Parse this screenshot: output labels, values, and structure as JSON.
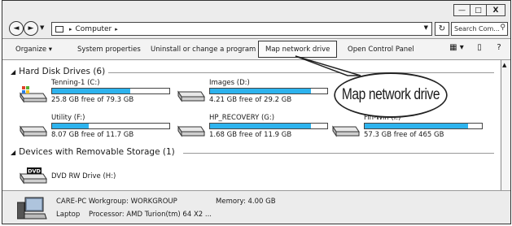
{
  "window": {
    "minimize": "—",
    "maximize": "□",
    "close": "X"
  },
  "address": {
    "back": "◄",
    "forward": "►",
    "separator": "▸",
    "path": "Computer",
    "path_separator": "▸",
    "dropdown": "▼",
    "refresh": "↻",
    "search_placeholder": "Search Com...",
    "search_icon": "magnifier-icon"
  },
  "toolbar": {
    "organize": "Organize ▾",
    "system_properties": "System properties",
    "uninstall": "Uninstall or change a program",
    "map_network_drive": "Map network drive",
    "open_control_panel": "Open Control Panel",
    "view_icon": "▦ ▾",
    "pane_icon": "▯",
    "help_icon": "?"
  },
  "groups": {
    "hard_disk": "Hard Disk Drives (6)",
    "removable": "Devices with Removable Storage (1)"
  },
  "drives": [
    {
      "name": "Tenning-1 (C:)",
      "free": "25.8 GB free of 79.3 GB",
      "used_fraction": 0.67
    },
    {
      "name": "Images (D:)",
      "free": "4.21 GB free of 29.2 GB",
      "used_fraction": 0.86
    },
    {
      "name": "Utility (F:)",
      "free": "8.07 GB free of 11.7 GB",
      "used_fraction": 0.31
    },
    {
      "name": "HP_RECOVERY (G:)",
      "free": "1.68 GB free of 11.9 GB",
      "used_fraction": 0.86
    },
    {
      "name": "Fin-Win (I:)",
      "free": "57.3 GB free of 465 GB",
      "used_fraction": 0.88
    }
  ],
  "dvd": {
    "name": "DVD RW Drive (H:)",
    "label": "DVD"
  },
  "callout": "Map network drive",
  "details": {
    "line1": "CARE-PC  Workgroup: WORKGROUP",
    "memory": "Memory: 4.00 GB",
    "type": "Laptop",
    "processor": "Processor: AMD Turion(tm) 64 X2 ..."
  },
  "colors": {
    "bar_fill": "#2db3ee"
  }
}
